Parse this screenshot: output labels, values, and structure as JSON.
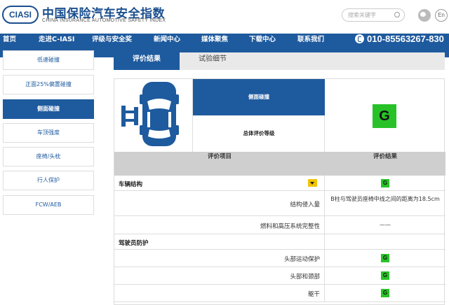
{
  "header": {
    "logo_text": "CIASI",
    "title": "中国保险汽车安全指数",
    "subtitle": "CHINA INSURANCE AUTOMOTIVE SAFETY INDEX",
    "search_placeholder": "搜索关键字",
    "lang_label": "En"
  },
  "nav": {
    "items": [
      "首页",
      "走进C-IASI",
      "评级与安全奖",
      "新闻中心",
      "媒体聚焦",
      "下载中心",
      "联系我们"
    ],
    "phone": "010-85563267-830"
  },
  "sidebar": {
    "items": [
      "低速碰撞",
      "正面25%偏置碰撞",
      "侧面碰撞",
      "车顶强度",
      "座椅/头枕",
      "行人保护",
      "FCW/AEB"
    ],
    "active_index": 2
  },
  "tabs": [
    "评价结果",
    "试验细节"
  ],
  "summary": {
    "test_name": "侧面碰撞",
    "overall_label": "总体评价等级",
    "overall_rating": "G"
  },
  "table": {
    "col_item": "评价项目",
    "col_result": "评价结果",
    "rows": [
      {
        "category": "车辆结构",
        "rating": "G"
      },
      {
        "sub": "结构侵入量",
        "result": "B柱与驾驶员座椅中线之间的距离为18.5cm"
      },
      {
        "sub": "燃料和高压系统完整性",
        "result": "——"
      },
      {
        "category": "驾驶员防护"
      },
      {
        "sub": "头部运动保护",
        "rating": "G"
      },
      {
        "sub": "头部和颈部",
        "rating": "G"
      },
      {
        "sub": "躯干",
        "rating": "G"
      }
    ]
  },
  "colors": {
    "brand_blue": "#1e5a9e",
    "rating_green": "#28c228",
    "expand_yellow": "#f2c400"
  }
}
